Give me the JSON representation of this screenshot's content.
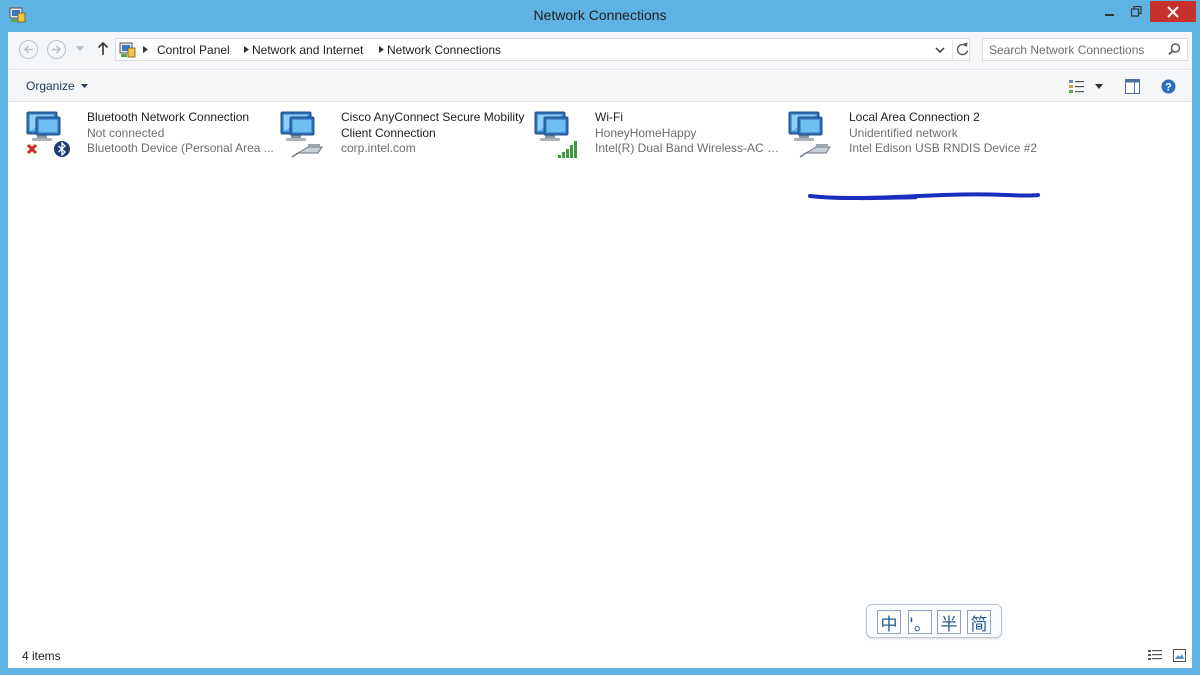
{
  "window": {
    "title": "Network Connections"
  },
  "address_bar": {
    "breadcrumbs": [
      "Control Panel",
      "Network and Internet",
      "Network Connections"
    ]
  },
  "search": {
    "placeholder": "Search Network Connections"
  },
  "command_bar": {
    "organize_label": "Organize"
  },
  "connections": [
    {
      "name": "Bluetooth Network Connection",
      "status": "Not connected",
      "device": "Bluetooth Device (Personal Area ...",
      "icon": "network-disconnected-bluetooth-icon"
    },
    {
      "name": "Cisco AnyConnect Secure Mobility Client Connection",
      "status": "corp.intel.com",
      "device": "",
      "icon": "network-cable-icon"
    },
    {
      "name": "Wi-Fi",
      "status": "HoneyHomeHappy",
      "device": "Intel(R) Dual Band Wireless-AC 72...",
      "icon": "network-wifi-signal-icon"
    },
    {
      "name": "Local Area Connection 2",
      "status": "Unidentified network",
      "device": "Intel Edison USB RNDIS Device #2",
      "icon": "network-cable-icon"
    }
  ],
  "status_bar": {
    "item_count": "4 items"
  },
  "ime_bar": {
    "buttons": [
      "中",
      "'。",
      "半",
      "简"
    ]
  },
  "colors": {
    "window_frame": "#5eb3e3",
    "close_button": "#c7312b",
    "highlight_stroke": "#1b2fbf",
    "organize_text": "#1e395b"
  }
}
